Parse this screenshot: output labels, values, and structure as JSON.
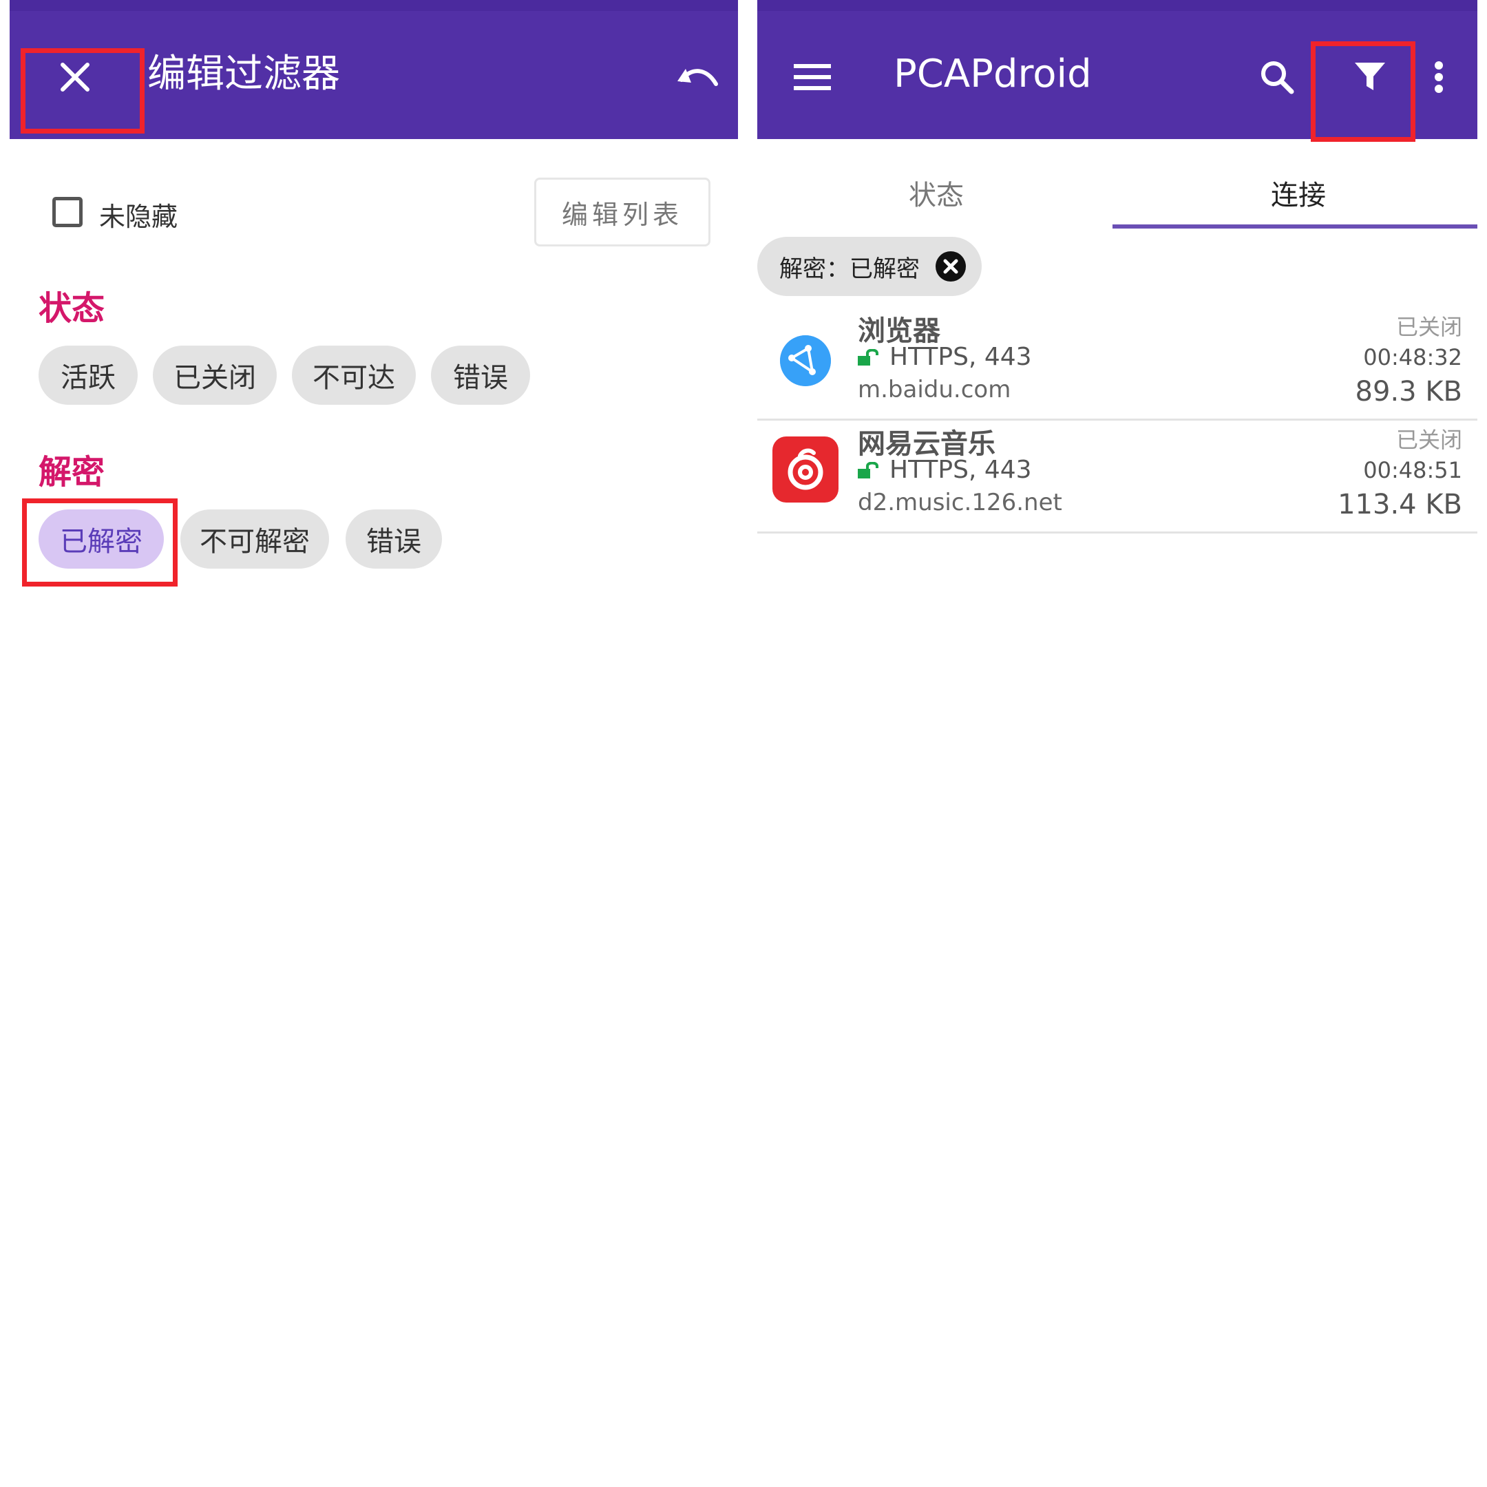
{
  "left_screen": {
    "appbar": {
      "title": "编辑过滤器",
      "close_icon": "close-icon",
      "undo_icon": "undo-icon"
    },
    "unhidden_checkbox": {
      "label": "未隐藏",
      "checked": false
    },
    "edit_list_button": "编辑列表",
    "status_section": {
      "title": "状态",
      "chips": [
        "活跃",
        "已关闭",
        "不可达",
        "错误"
      ]
    },
    "decryption_section": {
      "title": "解密",
      "chips": [
        "已解密",
        "不可解密",
        "错误"
      ],
      "selected": "已解密"
    }
  },
  "right_screen": {
    "appbar": {
      "title": "PCAPdroid",
      "menu_icon": "menu-icon",
      "search_icon": "search-icon",
      "filter_icon": "filter-icon",
      "more_icon": "more-vert-icon"
    },
    "tabs": [
      {
        "label": "状态",
        "active": false
      },
      {
        "label": "连接",
        "active": true
      }
    ],
    "active_filter_chip": {
      "label": "解密：已解密",
      "remove_icon": "close-circle-icon"
    },
    "connections": [
      {
        "app": "浏览器",
        "icon": "browser-globe-icon",
        "protocol": "HTTPS, 443",
        "host": "m.baidu.com",
        "status": "已关闭",
        "time": "00:48:32",
        "size": "89.3 KB"
      },
      {
        "app": "网易云音乐",
        "icon": "netease-music-icon",
        "protocol": "HTTPS, 443",
        "host": "d2.music.126.net",
        "status": "已关闭",
        "time": "00:48:51",
        "size": "113.4 KB"
      }
    ]
  },
  "colors": {
    "appbar": "#5230a6",
    "accent_section_title": "#d4176a",
    "selected_chip_bg": "#d8c6f3",
    "tab_indicator": "#6a4fb5",
    "highlight_box": "#f0232b",
    "lock_green": "#1aa64a"
  }
}
